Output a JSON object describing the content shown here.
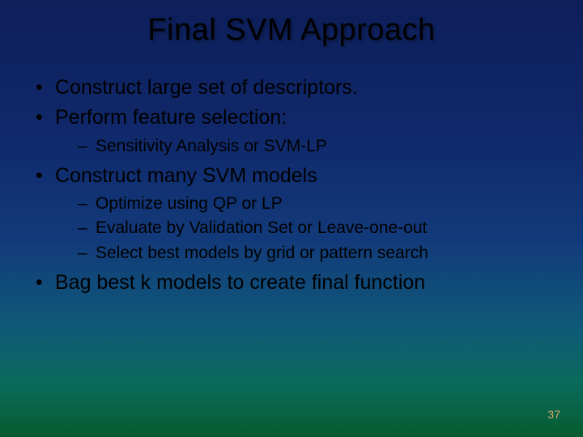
{
  "title": "Final SVM Approach",
  "bullets": [
    {
      "text": "Construct large set of descriptors.",
      "sub": []
    },
    {
      "text": "Perform feature selection:",
      "sub": [
        "Sensitivity Analysis or  SVM-LP"
      ]
    },
    {
      "text": "Construct many SVM models",
      "sub": [
        "Optimize using QP or LP",
        "Evaluate by Validation Set or Leave-one-out",
        "Select best models  by grid or pattern search"
      ]
    },
    {
      "text": "Bag best k models to create final function",
      "sub": []
    }
  ],
  "page_number": "37"
}
